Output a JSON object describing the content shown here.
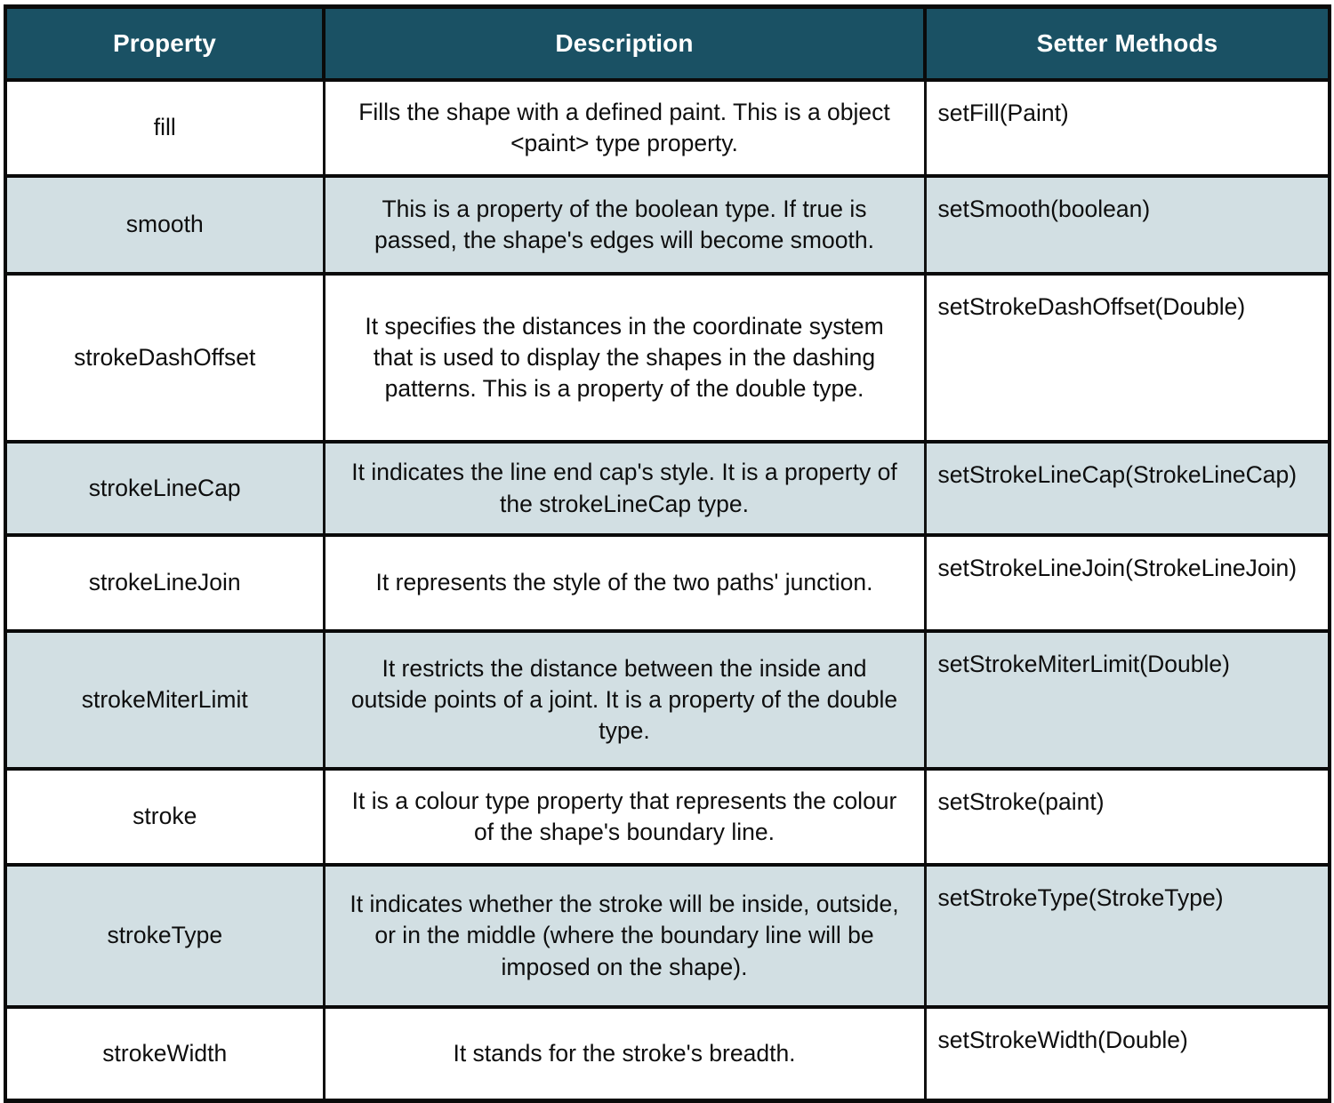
{
  "table": {
    "columns": [
      "Property",
      "Description",
      "Setter Methods"
    ],
    "rows": [
      {
        "property": "fill",
        "description": "Fills the shape with a defined paint. This is a object <paint> type property.",
        "setter": "setFill(Paint)"
      },
      {
        "property": "smooth",
        "description": "This is a property of the boolean type. If true is passed, the shape's edges will become smooth.",
        "setter": "setSmooth(boolean)"
      },
      {
        "property": "strokeDashOffset",
        "description": "It specifies the distances in the coordinate system that is used to display the shapes in the dashing patterns. This is a property of the double type.",
        "setter": "setStrokeDashOffset(Double)"
      },
      {
        "property": "strokeLineCap",
        "description": "It indicates the line end cap's style. It is a property of the strokeLineCap type.",
        "setter": "setStrokeLineCap(StrokeLineCap)"
      },
      {
        "property": "strokeLineJoin",
        "description": "It represents the style of the two paths' junction.",
        "setter": "setStrokeLineJoin(StrokeLineJoin)"
      },
      {
        "property": "strokeMiterLimit",
        "description": "It restricts the distance between the inside and outside points of a joint. It is a property of the double type.",
        "setter": "setStrokeMiterLimit(Double)"
      },
      {
        "property": "stroke",
        "description": "It is a colour type property that represents the colour of the shape's boundary line.",
        "setter": "setStroke(paint)"
      },
      {
        "property": "strokeType",
        "description": "It indicates whether the stroke will be inside, outside, or in the middle (where the boundary line will be imposed on the shape).",
        "setter": "setStrokeType(StrokeType)"
      },
      {
        "property": "strokeWidth",
        "description": "It stands for the stroke's breadth.",
        "setter": "setStrokeWidth(Double)"
      }
    ]
  },
  "colors": {
    "header_background": "#1a5164",
    "header_text": "#ffffff",
    "alt_row_background": "#d2dfe3",
    "row_background": "#ffffff",
    "border": "#0a0a0a",
    "body_text": "#0e0e0e"
  }
}
